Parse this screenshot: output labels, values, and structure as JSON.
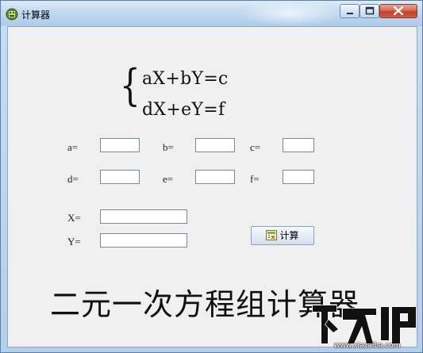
{
  "window": {
    "title": "计算器",
    "controls": {
      "minimize": "—",
      "maximize": "□",
      "close": "✕"
    }
  },
  "equations": {
    "line1": "aX+bY=c",
    "line2": "dX+eY=f"
  },
  "fields": {
    "a": {
      "label": "a=",
      "value": ""
    },
    "b": {
      "label": "b=",
      "value": ""
    },
    "c": {
      "label": "c=",
      "value": ""
    },
    "d": {
      "label": "d=",
      "value": ""
    },
    "e": {
      "label": "e=",
      "value": ""
    },
    "f": {
      "label": "f=",
      "value": ""
    },
    "x": {
      "label": "X=",
      "value": ""
    },
    "y": {
      "label": "Y=",
      "value": ""
    }
  },
  "calculate_button": {
    "label": "计算",
    "icon": "calculator-icon"
  },
  "app_title": "二元一次方程组计算器",
  "watermark": {
    "url": "www.xiazaiba.com"
  },
  "colors": {
    "title_bar": "#c1d9f0",
    "close_button": "#c1412a",
    "client_bg": "#f0f0f0"
  }
}
